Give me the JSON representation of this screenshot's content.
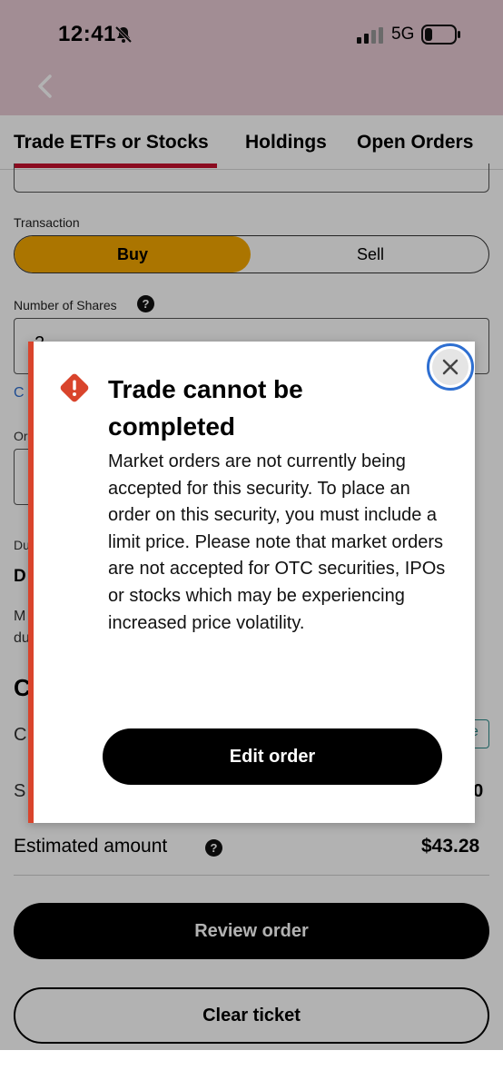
{
  "status_bar": {
    "time": "12:41",
    "network": "5G"
  },
  "tabs": [
    {
      "label": "Trade ETFs or Stocks",
      "active": true
    },
    {
      "label": "Holdings",
      "active": false
    },
    {
      "label": "Open Orders",
      "active": false
    }
  ],
  "form": {
    "transaction_label": "Transaction",
    "buy_label": "Buy",
    "sell_label": "Sell",
    "shares_label": "Number of Shares",
    "shares_value": "2",
    "fragment_c": "C",
    "fragment_or": "Or",
    "fragment_du": "Du",
    "fragment_d": "D",
    "fragment_m": "M",
    "fragment_du2": "du",
    "fragment_big_c": "C",
    "fragment_c2": "C",
    "fragment_e": "e",
    "fragment_s": "S",
    "fragment_00": "00",
    "estimated_label": "Estimated amount",
    "estimated_value": "$43.28",
    "review_button": "Review order",
    "clear_button": "Clear ticket"
  },
  "modal": {
    "title": "Trade cannot be completed",
    "body": "Market orders are not currently being accepted for this security. To place an order on this security, you must include a limit price. Please note that market orders are not accepted for OTC securities, IPOs or stocks which may be experiencing increased price volatility.",
    "edit_button": "Edit order"
  },
  "colors": {
    "header_bg": "#e9cad5",
    "tab_accent": "#c8102e",
    "buy_selected": "#f5a800",
    "alert_red": "#d9442c",
    "focus_ring": "#2e6fd1"
  }
}
